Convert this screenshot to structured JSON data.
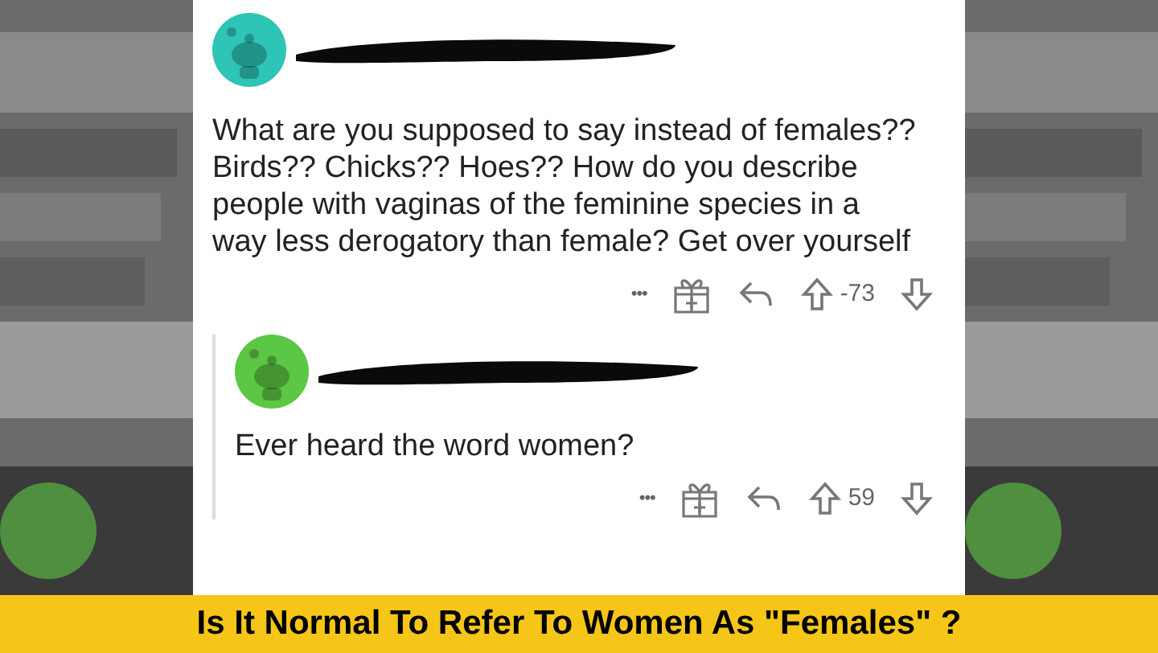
{
  "comments": [
    {
      "color": "#2ec4b6",
      "text": "What are you supposed to say instead of females?? Birds?? Chicks?? Hoes?? How do you describe people with vaginas of the feminine species in a way less derogatory than female? Get over yourself",
      "more": "•••",
      "score": "-73",
      "children": [
        {
          "color": "#5cc645",
          "text": "Ever heard the word women?",
          "more": "•••",
          "score": "59"
        }
      ]
    }
  ],
  "caption": "Is It Normal To Refer To Women As \"Females\" ?"
}
